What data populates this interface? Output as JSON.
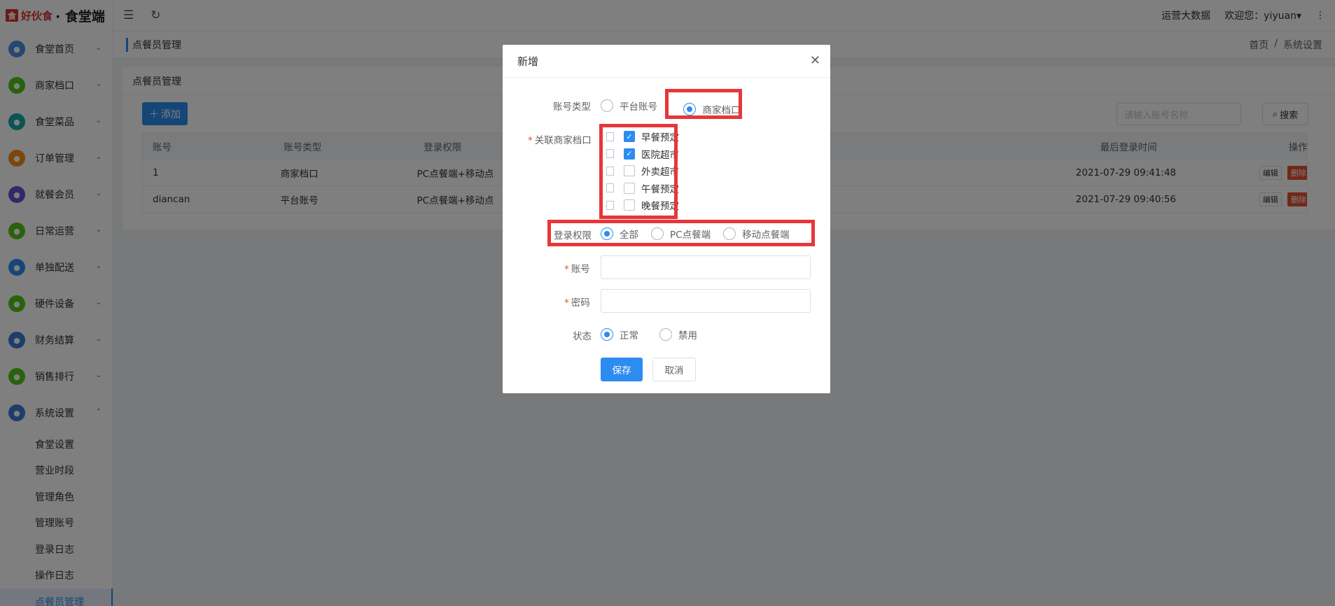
{
  "app": {
    "brand": "好伙食",
    "app_name": "食堂端",
    "logo_mark": "食"
  },
  "colors": {
    "accent": "#2d8cf0",
    "danger": "#e6502e",
    "highlight_box": "#e8363a"
  },
  "sidebar": {
    "items": [
      {
        "label": "食堂首页",
        "icon": "home-icon",
        "color": "#4a90e2"
      },
      {
        "label": "商家档口",
        "icon": "store-icon",
        "color": "#52c41a"
      },
      {
        "label": "食堂菜品",
        "icon": "dish-icon",
        "color": "#13a8a8"
      },
      {
        "label": "订单管理",
        "icon": "cart-icon",
        "color": "#fa8c16"
      },
      {
        "label": "就餐会员",
        "icon": "member-icon",
        "color": "#6f4dd1"
      },
      {
        "label": "日常运营",
        "icon": "calendar-icon",
        "color": "#52c41a"
      },
      {
        "label": "单独配送",
        "icon": "send-icon",
        "color": "#2d8cf0"
      },
      {
        "label": "硬件设备",
        "icon": "wifi-icon",
        "color": "#52c41a"
      },
      {
        "label": "财务结算",
        "icon": "finance-icon",
        "color": "#3a7bd5"
      },
      {
        "label": "销售排行",
        "icon": "rank-icon",
        "color": "#52c41a"
      },
      {
        "label": "系统设置",
        "icon": "settings-icon",
        "color": "#3a7bd5"
      }
    ],
    "submenu": [
      "食堂设置",
      "营业时段",
      "管理角色",
      "管理账号",
      "登录日志",
      "操作日志",
      "点餐员管理"
    ]
  },
  "header": {
    "big_data": "运营大数据",
    "welcome": "欢迎您：yiyuan",
    "more": "⋮"
  },
  "breadcrumb": {
    "title": "点餐员管理",
    "home": "首页",
    "sep": "/",
    "current": "系统设置"
  },
  "card": {
    "title": "点餐员管理",
    "add_label": "添加",
    "search_placeholder": "请输入账号名称",
    "search_label": "搜索",
    "columns": [
      "账号",
      "账号类型",
      "登录权限",
      "",
      "最后登录时间",
      "操作"
    ],
    "rows": [
      [
        "1",
        "商家档口",
        "PC点餐端+移动点",
        "",
        "2021-07-29 09:41:48"
      ],
      [
        "diancan",
        "平台账号",
        "PC点餐端+移动点",
        "",
        "2021-07-29 09:40:56"
      ]
    ],
    "edit_label": "编辑",
    "delete_label": "删除"
  },
  "dialog": {
    "title": "新增",
    "account_type_label": "账号类型",
    "account_type_options": [
      "平台账号",
      "商家档口"
    ],
    "account_type_selected": "商家档口",
    "stalls_label": "关联商家档口",
    "stalls": [
      {
        "label": "早餐预定",
        "checked": true
      },
      {
        "label": "医院超市",
        "checked": true
      },
      {
        "label": "外卖超市",
        "checked": false
      },
      {
        "label": "午餐预定",
        "checked": false
      },
      {
        "label": "晚餐预定",
        "checked": false
      }
    ],
    "permission_label": "登录权限",
    "permission_options": [
      "全部",
      "PC点餐端",
      "移动点餐端"
    ],
    "permission_selected": "全部",
    "account_label": "账号",
    "account_value": "",
    "password_label": "密码",
    "password_value": "",
    "status_label": "状态",
    "status_options": [
      "正常",
      "禁用"
    ],
    "status_selected": "正常",
    "save_label": "保存",
    "cancel_label": "取消",
    "required_mark": "*"
  }
}
